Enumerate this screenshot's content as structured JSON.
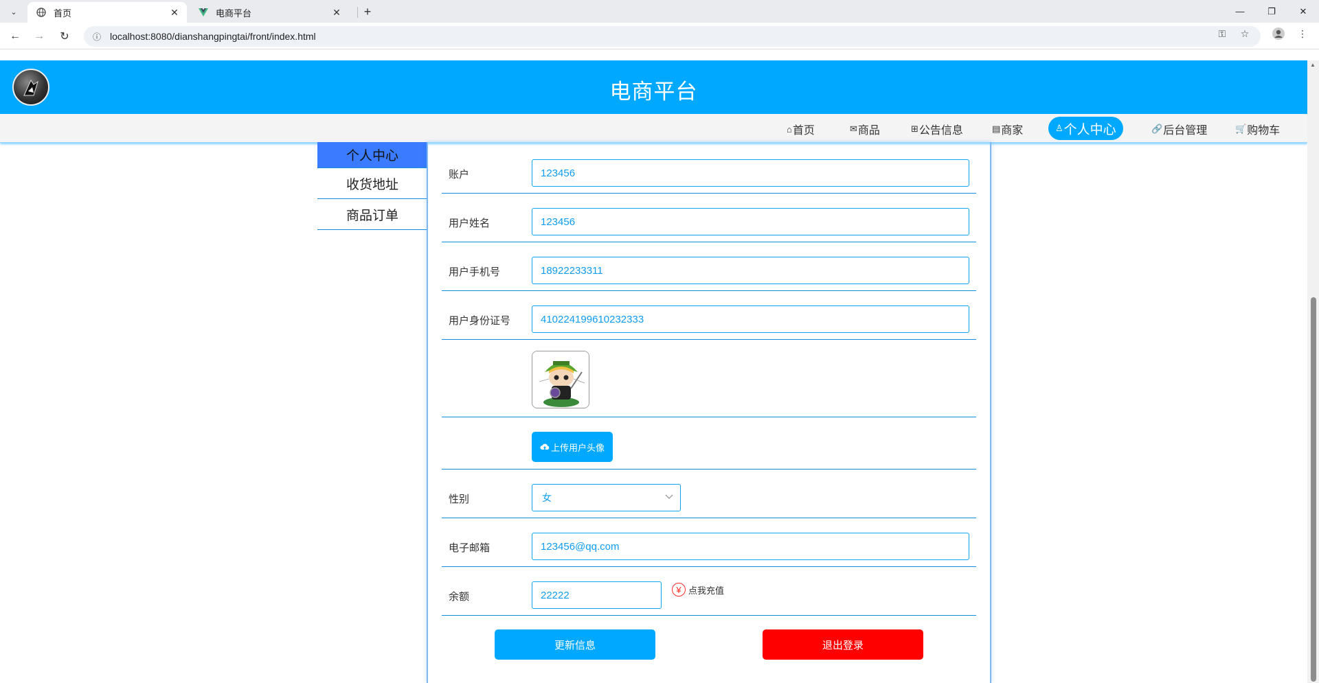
{
  "browser": {
    "tabs": [
      {
        "title": "首页",
        "icon": "globe-icon",
        "active": true
      },
      {
        "title": "电商平台",
        "icon": "vue-icon",
        "active": false
      }
    ],
    "url": "localhost:8080/dianshangpingtai/front/index.html"
  },
  "site": {
    "title": "电商平台"
  },
  "nav": [
    {
      "label": "首页",
      "icon": "⌂"
    },
    {
      "label": "商品",
      "icon": "✉"
    },
    {
      "label": "公告信息",
      "icon": "⊞"
    },
    {
      "label": "商家",
      "icon": "▤"
    },
    {
      "label": "个人中心",
      "icon": "♙",
      "active": true
    },
    {
      "label": "后台管理",
      "icon": "🔗"
    },
    {
      "label": "购物车",
      "icon": "🛒"
    }
  ],
  "sidebar": {
    "items": [
      {
        "label": "个人中心",
        "active": true
      },
      {
        "label": "收货地址"
      },
      {
        "label": "商品订单"
      }
    ]
  },
  "form": {
    "account": {
      "label": "账户",
      "value": "123456"
    },
    "name": {
      "label": "用户姓名",
      "value": "123456"
    },
    "phone": {
      "label": "用户手机号",
      "value": "18922233311"
    },
    "id_card": {
      "label": "用户身份证号",
      "value": "410224199610232333"
    },
    "upload_label": "上传用户头像",
    "gender": {
      "label": "性别",
      "value": "女"
    },
    "email": {
      "label": "电子邮箱",
      "value": "123456@qq.com"
    },
    "balance": {
      "label": "余额",
      "value": "22222",
      "recharge_label": "点我充值",
      "currency_symbol": "¥"
    },
    "update_label": "更新信息",
    "logout_label": "退出登录"
  },
  "colors": {
    "brand": "#00a9ff",
    "danger": "#ff0000",
    "sidebar_active": "#3a7bff"
  }
}
